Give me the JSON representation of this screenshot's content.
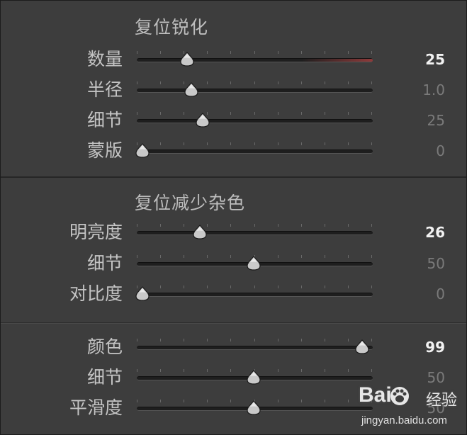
{
  "sections": [
    {
      "title": "复位锐化",
      "rows": [
        {
          "label": "数量",
          "value": "25",
          "fraction": 0.2,
          "active": true,
          "fill": true
        },
        {
          "label": "半径",
          "value": "1.0",
          "fraction": 0.22,
          "active": false,
          "fill": false
        },
        {
          "label": "细节",
          "value": "25",
          "fraction": 0.27,
          "active": false,
          "fill": false
        },
        {
          "label": "蒙版",
          "value": "0",
          "fraction": 0.0,
          "active": false,
          "fill": false
        }
      ]
    },
    {
      "title": "复位减少杂色",
      "rows": [
        {
          "label": "明亮度",
          "value": "26",
          "fraction": 0.26,
          "active": true,
          "fill": false
        },
        {
          "label": "细节",
          "value": "50",
          "fraction": 0.5,
          "active": false,
          "fill": false
        },
        {
          "label": "对比度",
          "value": "0",
          "fraction": 0.0,
          "active": false,
          "fill": false
        }
      ]
    },
    {
      "title": "",
      "rows": [
        {
          "label": "颜色",
          "value": "99",
          "fraction": 0.99,
          "active": true,
          "fill": false
        },
        {
          "label": "细节",
          "value": "50",
          "fraction": 0.5,
          "active": false,
          "fill": false
        },
        {
          "label": "平滑度",
          "value": "50",
          "fraction": 0.5,
          "active": false,
          "fill": false
        }
      ]
    }
  ],
  "watermark": {
    "logo": "Bai",
    "logo_suffix": "",
    "chinese": "经验",
    "url": "jingyan.baidu.com"
  },
  "colors": {
    "panel_bg": "#3d3d3d",
    "track": "#1e1e1e",
    "active_value": "#f2f2f2",
    "dim_value": "#7a7a7a",
    "amount_fill": "#8e3a3a"
  }
}
